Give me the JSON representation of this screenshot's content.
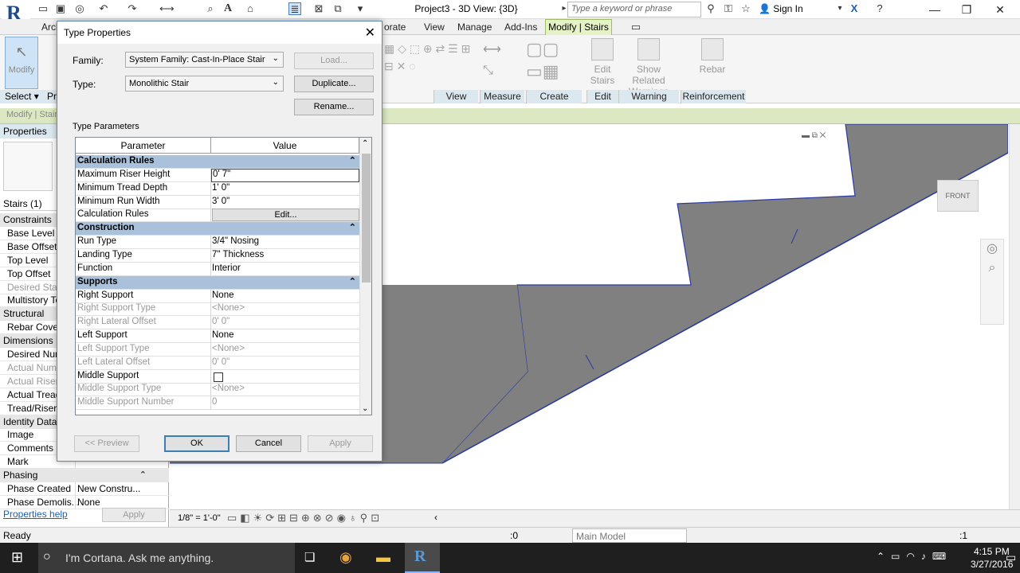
{
  "titlebar": {
    "title": "Project3 - 3D View: {3D}",
    "search_placeholder": "Type a keyword or phrase",
    "sign_in": "Sign In"
  },
  "ribbon": {
    "tabs": [
      "Arch",
      "orate",
      "View",
      "Manage",
      "Add-Ins",
      "Modify | Stairs"
    ],
    "modify_label": "Modify",
    "select_label": "Select",
    "panels": [
      "View",
      "Measure",
      "Create",
      "Edit",
      "Warning",
      "Reinforcement"
    ],
    "edit_stairs": "Edit Stairs",
    "show_warnings": "Show Related Warnings",
    "rebar": "Rebar"
  },
  "context_bar": {
    "text": "Modify | Stair"
  },
  "properties": {
    "title": "Properties",
    "selector": "Stairs (1)",
    "help_link": "Properties help",
    "apply": "Apply",
    "rows": [
      {
        "label": "Constraints",
        "cat": true
      },
      {
        "label": "Base Level"
      },
      {
        "label": "Base Offset"
      },
      {
        "label": "Top Level"
      },
      {
        "label": "Top Offset"
      },
      {
        "label": "Desired Stair",
        "dim": true
      },
      {
        "label": "Multistory To"
      },
      {
        "label": "Structural",
        "cat": true
      },
      {
        "label": "Rebar Cover"
      },
      {
        "label": "Dimensions",
        "cat": true
      },
      {
        "label": "Desired Num"
      },
      {
        "label": "Actual Numb",
        "dim": true
      },
      {
        "label": "Actual Riser",
        "dim": true
      },
      {
        "label": "Actual Tread"
      },
      {
        "label": "Tread/Riser S"
      },
      {
        "label": "Identity Data",
        "cat": true
      },
      {
        "label": "Image"
      },
      {
        "label": "Comments"
      },
      {
        "label": "Mark"
      },
      {
        "label": "Phasing",
        "cat": true
      },
      {
        "label": "Phase Created",
        "value": "New Constru..."
      },
      {
        "label": "Phase Demolis...",
        "value": "None"
      }
    ]
  },
  "dialog": {
    "title": "Type Properties",
    "family_label": "Family:",
    "family_value": "System Family: Cast-In-Place Stair",
    "type_label": "Type:",
    "type_value": "Monolithic Stair",
    "load": "Load...",
    "duplicate": "Duplicate...",
    "rename": "Rename...",
    "section": "Type Parameters",
    "col_param": "Parameter",
    "col_value": "Value",
    "rows": [
      {
        "cat": true,
        "name": "Calculation Rules",
        "value": ""
      },
      {
        "name": "Maximum Riser Height",
        "value": "0'  7\"",
        "edit": true
      },
      {
        "name": "Minimum Tread Depth",
        "value": "1'  0\""
      },
      {
        "name": "Minimum Run Width",
        "value": "3'  0\""
      },
      {
        "name": "Calculation Rules",
        "value": "Edit...",
        "button": true
      },
      {
        "cat": true,
        "name": "Construction",
        "value": ""
      },
      {
        "name": "Run Type",
        "value": "3/4\" Nosing"
      },
      {
        "name": "Landing Type",
        "value": "7\" Thickness"
      },
      {
        "name": "Function",
        "value": "Interior"
      },
      {
        "cat": true,
        "name": "Supports",
        "value": ""
      },
      {
        "name": "Right Support",
        "value": "None"
      },
      {
        "name": "Right Support Type",
        "value": "<None>",
        "dim": true
      },
      {
        "name": "Right Lateral Offset",
        "value": "0'  0\"",
        "dim": true
      },
      {
        "name": "Left Support",
        "value": "None"
      },
      {
        "name": "Left Support Type",
        "value": "<None>",
        "dim": true
      },
      {
        "name": "Left Lateral Offset",
        "value": "0'  0\"",
        "dim": true
      },
      {
        "name": "Middle Support",
        "value": "",
        "checkbox": true
      },
      {
        "name": "Middle Support Type",
        "value": "<None>",
        "dim": true
      },
      {
        "name": "Middle Support Number",
        "value": "0",
        "dim": true
      }
    ],
    "preview": "<< Preview",
    "ok": "OK",
    "cancel": "Cancel",
    "apply": "Apply"
  },
  "canvas": {
    "viewcube_label": "FRONT"
  },
  "viewbar": {
    "scale": "1/8\" = 1'-0\""
  },
  "status": {
    "text": "Ready",
    "count": ":0",
    "model": "Main Model",
    "filter": ":1"
  },
  "taskbar": {
    "cortana": "I'm Cortana. Ask me anything.",
    "time": "4:15 PM",
    "date": "3/27/2016"
  }
}
